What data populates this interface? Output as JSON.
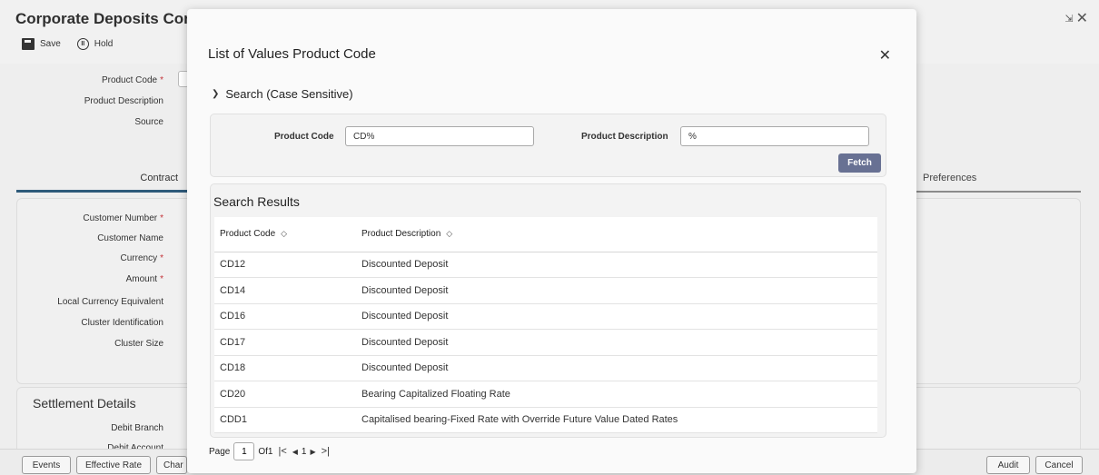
{
  "window": {
    "title": "Corporate Deposits Con",
    "resize_icon": "resize-icon",
    "close_icon": "close-icon"
  },
  "toolbar": {
    "save_label": "Save",
    "hold_label": "Hold"
  },
  "bg_form": {
    "product_code_label": "Product Code",
    "product_description_label": "Product Description",
    "source_label": "Source",
    "tab_contract": "Contract",
    "tab_preferences": "Preferences",
    "customer_number_label": "Customer Number",
    "customer_name_label": "Customer Name",
    "currency_label": "Currency",
    "amount_label": "Amount",
    "lce_label": "Local Currency Equivalent",
    "cluster_id_label": "Cluster Identification",
    "cluster_size_label": "Cluster Size",
    "settlement_title": "Settlement Details",
    "debit_branch_label": "Debit Branch",
    "debit_account_label": "Debit Account",
    "required_mark": "*"
  },
  "footer": {
    "events": "Events",
    "effective_rate": "Effective Rate",
    "charges": "Char",
    "audit": "Audit",
    "cancel": "Cancel"
  },
  "modal": {
    "title": "List of Values Product Code",
    "search_toggle": "Search (Case Sensitive)",
    "search": {
      "product_code_label": "Product Code",
      "product_code_value": "CD%",
      "product_description_label": "Product Description",
      "product_description_value": "%",
      "fetch_label": "Fetch"
    },
    "results": {
      "title": "Search Results",
      "columns": [
        "Product Code",
        "Product Description"
      ],
      "rows": [
        [
          "CD12",
          "Discounted Deposit"
        ],
        [
          "CD14",
          "Discounted Deposit"
        ],
        [
          "CD16",
          "Discounted Deposit"
        ],
        [
          "CD17",
          "Discounted Deposit"
        ],
        [
          "CD18",
          "Discounted Deposit"
        ],
        [
          "CD20",
          "Bearing Capitalized Floating Rate"
        ],
        [
          "CDD1",
          "Capitalised bearing-Fixed Rate with Override Future Value Dated Rates"
        ]
      ]
    },
    "pager": {
      "page_label": "Page",
      "page_value": "1",
      "of_label": "Of",
      "total_pages": "1",
      "current": "1"
    }
  },
  "colors": {
    "fetch_button": "#687193",
    "required": "#c4343a",
    "tab_underline": "#2e5a7a"
  }
}
